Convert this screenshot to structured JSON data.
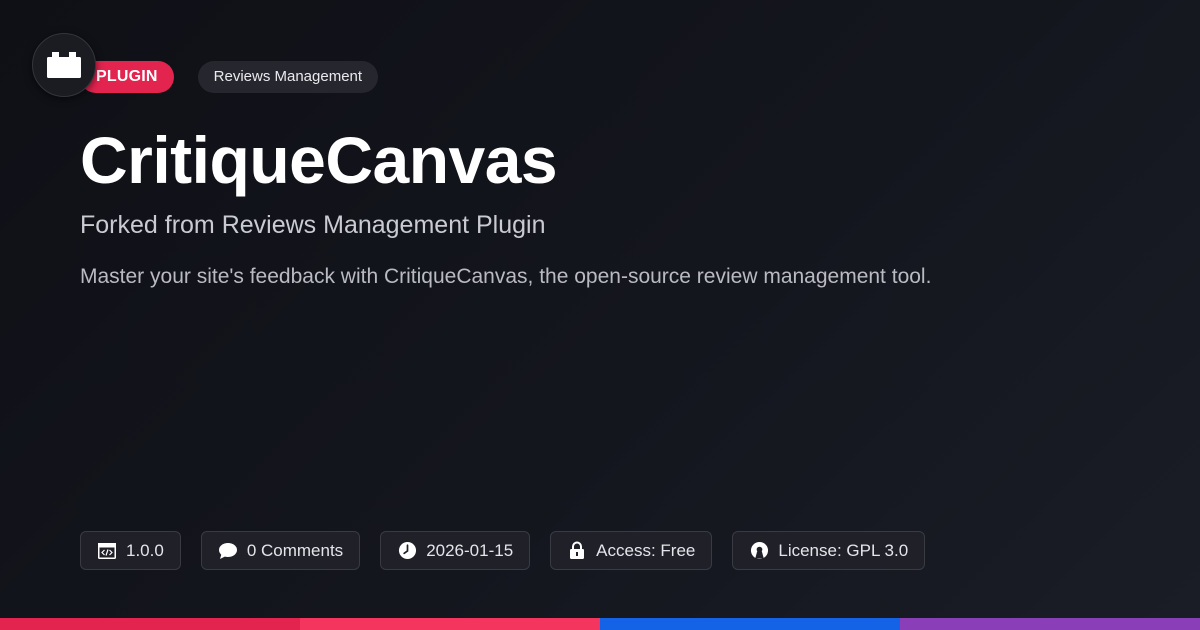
{
  "header": {
    "logo_icon": "plugin-block-icon",
    "type_badge": "PLUGIN",
    "category": "Reviews Management"
  },
  "main": {
    "title": "CritiqueCanvas",
    "subtitle": "Forked from Reviews Management Plugin",
    "description": "Master your site's feedback with CritiqueCanvas, the open-source review management tool."
  },
  "meta": [
    {
      "icon": "code-window-icon",
      "label": "1.0.0"
    },
    {
      "icon": "comment-bubble-icon",
      "label": "0 Comments"
    },
    {
      "icon": "clock-icon",
      "label": "2026-01-15"
    },
    {
      "icon": "lock-icon",
      "label": "Access: Free"
    },
    {
      "icon": "open-source-icon",
      "label": "License: GPL 3.0"
    }
  ],
  "colors": {
    "accent": "#e2244f",
    "bar": [
      "#e2244f",
      "#f4365f",
      "#1463e6",
      "#8a3fb8"
    ]
  }
}
